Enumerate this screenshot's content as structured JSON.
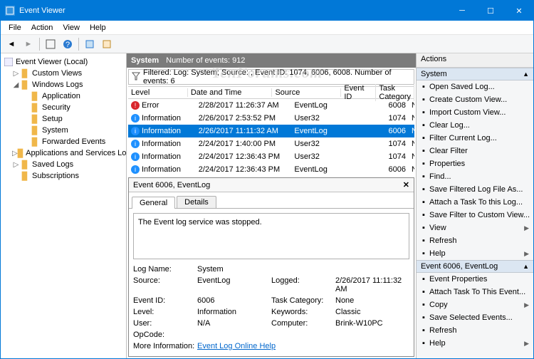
{
  "window": {
    "title": "Event Viewer"
  },
  "menus": [
    "File",
    "Action",
    "View",
    "Help"
  ],
  "watermark": "TenForums.com",
  "tree": {
    "root": "Event Viewer (Local)",
    "items": [
      {
        "label": "Custom Views",
        "indent": 1,
        "tw": "▷"
      },
      {
        "label": "Windows Logs",
        "indent": 1,
        "tw": "◢"
      },
      {
        "label": "Application",
        "indent": 2,
        "tw": ""
      },
      {
        "label": "Security",
        "indent": 2,
        "tw": ""
      },
      {
        "label": "Setup",
        "indent": 2,
        "tw": ""
      },
      {
        "label": "System",
        "indent": 2,
        "tw": ""
      },
      {
        "label": "Forwarded Events",
        "indent": 2,
        "tw": ""
      },
      {
        "label": "Applications and Services Logs",
        "indent": 1,
        "tw": "▷"
      },
      {
        "label": "Saved Logs",
        "indent": 1,
        "tw": "▷"
      },
      {
        "label": "Subscriptions",
        "indent": 1,
        "tw": ""
      }
    ]
  },
  "center": {
    "section": "System",
    "count_label": "Number of events: 912",
    "filter_text": "Filtered: Log: System; Source: ; Event ID: 1074, 6006, 6008. Number of events: 6",
    "columns": [
      "Level",
      "Date and Time",
      "Source",
      "Event ID",
      "Task Category"
    ],
    "rows": [
      {
        "level": "Error",
        "lvl": "err",
        "date": "2/28/2017 11:26:37 AM",
        "src": "EventLog",
        "id": "6008",
        "cat": "None"
      },
      {
        "level": "Information",
        "lvl": "info",
        "date": "2/26/2017 2:53:52 PM",
        "src": "User32",
        "id": "1074",
        "cat": "None"
      },
      {
        "level": "Information",
        "lvl": "info",
        "date": "2/26/2017 11:11:32 AM",
        "src": "EventLog",
        "id": "6006",
        "cat": "None",
        "sel": true
      },
      {
        "level": "Information",
        "lvl": "info",
        "date": "2/24/2017 1:40:00 PM",
        "src": "User32",
        "id": "1074",
        "cat": "None"
      },
      {
        "level": "Information",
        "lvl": "info",
        "date": "2/24/2017 12:36:43 PM",
        "src": "User32",
        "id": "1074",
        "cat": "None"
      },
      {
        "level": "Information",
        "lvl": "info",
        "date": "2/24/2017 12:36:43 PM",
        "src": "EventLog",
        "id": "6006",
        "cat": "None"
      }
    ]
  },
  "detail": {
    "title": "Event 6006, EventLog",
    "tabs": [
      "General",
      "Details"
    ],
    "message": "The Event log service was stopped.",
    "fields": {
      "log_name_l": "Log Name:",
      "log_name": "System",
      "source_l": "Source:",
      "source": "EventLog",
      "logged_l": "Logged:",
      "logged": "2/26/2017 11:11:32 AM",
      "event_id_l": "Event ID:",
      "event_id": "6006",
      "task_cat_l": "Task Category:",
      "task_cat": "None",
      "level_l": "Level:",
      "level": "Information",
      "keywords_l": "Keywords:",
      "keywords": "Classic",
      "user_l": "User:",
      "user": "N/A",
      "computer_l": "Computer:",
      "computer": "Brink-W10PC",
      "opcode_l": "OpCode:",
      "more_l": "More Information:",
      "more_link": "Event Log Online Help"
    }
  },
  "actions": {
    "header": "Actions",
    "sec1": "System",
    "items1": [
      "Open Saved Log...",
      "Create Custom View...",
      "Import Custom View...",
      "Clear Log...",
      "Filter Current Log...",
      "Clear Filter",
      "Properties",
      "Find...",
      "Save Filtered Log File As...",
      "Attach a Task To this Log...",
      "Save Filter to Custom View...",
      "View",
      "Refresh",
      "Help"
    ],
    "sec2": "Event 6006, EventLog",
    "items2": [
      "Event Properties",
      "Attach Task To This Event...",
      "Copy",
      "Save Selected Events...",
      "Refresh",
      "Help"
    ]
  }
}
